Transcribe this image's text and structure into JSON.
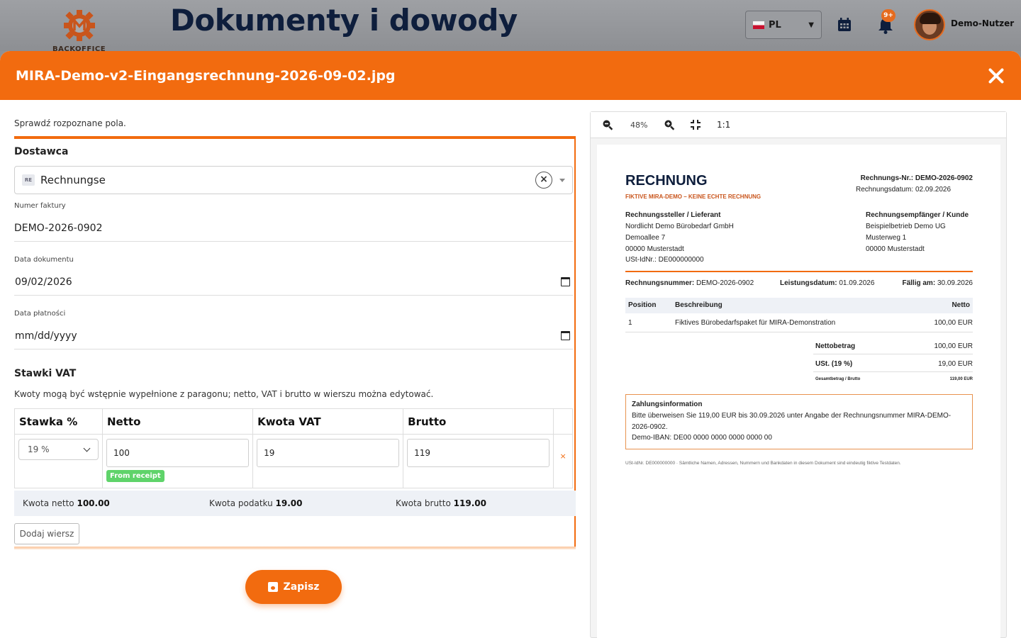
{
  "app": {
    "logo_text": "BACKOFFICE",
    "page_title": "Dokumenty i dowody",
    "language": "PL",
    "notifications_badge": "9+",
    "user_name": "Demo-Nutzer",
    "accent_color": "#f26b0f"
  },
  "modal": {
    "title": "MIRA-Demo-v2-Eingangsrechnung-2026-09-02.jpg",
    "close_icon": "close-icon"
  },
  "form": {
    "hint": "Sprawdź rozpoznane pola.",
    "supplier_label": "Dostawca",
    "supplier_tag": "RE",
    "supplier_value": "Rechnungse",
    "invoice_number_label": "Numer faktury",
    "invoice_number_value": "DEMO-2026-0902",
    "document_date_label": "Data dokumentu",
    "document_date_value": "09/02/2026",
    "payment_date_label": "Data płatności",
    "payment_date_value": "mm/dd/yyyy",
    "vat_section_label": "Stawki VAT",
    "vat_section_hint": "Kwoty mogą być wstępnie wypełnione z paragonu; netto, VAT i brutto w wierszu można edytować.",
    "vat_table": {
      "headers": [
        "Stawka %",
        "Netto",
        "Kwota VAT",
        "Brutto"
      ],
      "rows": [
        {
          "rate": "19 %",
          "net": "100",
          "vat": "19",
          "gross": "119",
          "source_badge": "From receipt",
          "delete": "×"
        }
      ]
    },
    "totals": {
      "net_label": "Kwota netto",
      "net_value": "100.00",
      "tax_label": "Kwota podatku",
      "tax_value": "19.00",
      "gross_label": "Kwota brutto",
      "gross_value": "119.00"
    },
    "add_row_label": "Dodaj wiersz",
    "save_label": "Zapisz"
  },
  "viewer": {
    "zoom_level": "48%",
    "reset_label": "1:1",
    "document": {
      "title": "RECHNUNG",
      "subtitle": "FIKTIVE MIRA-DEMO – KEINE ECHTE RECHNUNG",
      "invoice_no_label": "Rechnungs-Nr.:",
      "invoice_no": "DEMO-2026-0902",
      "invoice_date_label": "Rechnungsdatum:",
      "invoice_date": "02.09.2026",
      "seller_heading": "Rechnungssteller / Lieferant",
      "seller_lines": [
        "Nordlicht Demo Bürobedarf GmbH",
        "Demoallee 7",
        "00000 Musterstadt",
        "USt-IdNr.: DE000000000"
      ],
      "buyer_heading": "Rechnungsempfänger / Kunde",
      "buyer_lines": [
        "Beispielbetrieb Demo UG",
        "Musterweg 1",
        "00000 Musterstadt"
      ],
      "meta_number_label": "Rechnungsnummer:",
      "meta_number": "DEMO-2026-0902",
      "meta_service_label": "Leistungsdatum:",
      "meta_service": "01.09.2026",
      "meta_due_label": "Fällig am:",
      "meta_due": "30.09.2026",
      "table_headers": [
        "Position",
        "Beschreibung",
        "Netto"
      ],
      "table_rows": [
        [
          "1",
          "Fiktives Bürobedarfspaket für MIRA-Demonstration",
          "100,00 EUR"
        ]
      ],
      "net_label": "Nettobetrag",
      "net_value": "100,00 EUR",
      "vat_label": "USt. (19 %)",
      "vat_value": "19,00 EUR",
      "gross_label": "Gesamtbetrag / Brutto",
      "gross_value": "119,00 EUR",
      "payment_heading": "Zahlungsinformation",
      "payment_line1": "Bitte überweisen Sie 119,00 EUR bis 30.09.2026 unter Angabe der Rechnungsnummer MIRA-DEMO-",
      "payment_line2": "2026-0902.",
      "payment_line3": "Demo-IBAN: DE00 0000 0000 0000 0000 00",
      "footer": "USt-IdNr. DE000000000 · Sämtliche Namen, Adressen, Nummern und Bankdaten in diesem Dokument sind eindeutig fiktive Testdaten."
    }
  }
}
